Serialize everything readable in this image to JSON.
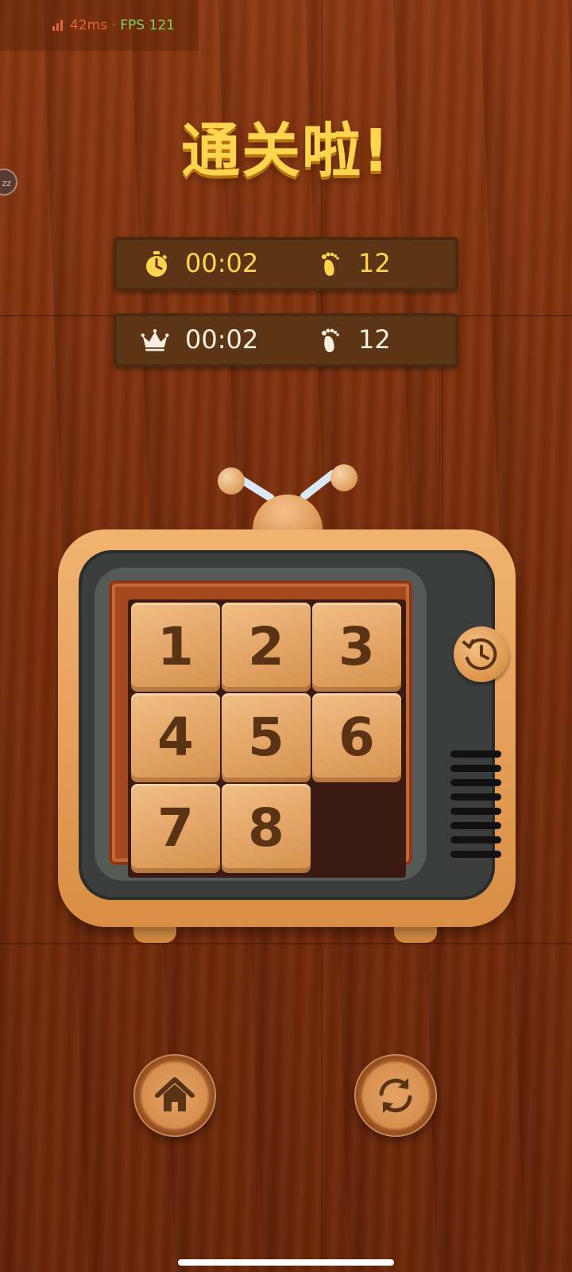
{
  "status": {
    "latency": "42ms",
    "separator": " · ",
    "fps": "FPS 121"
  },
  "side_chip": {
    "label": "zz"
  },
  "title": "通关啦!",
  "current": {
    "time": "00:02",
    "steps": "12",
    "time_icon": "stopwatch-icon",
    "steps_icon": "footprint-icon"
  },
  "best": {
    "time": "00:02",
    "steps": "12",
    "time_icon": "crown-icon",
    "steps_icon": "footprint-icon"
  },
  "board": {
    "tiles": [
      "1",
      "2",
      "3",
      "4",
      "5",
      "6",
      "7",
      "8"
    ],
    "empty_slot": 9
  },
  "buttons": {
    "undo_icon": "history-icon",
    "home_icon": "home-icon",
    "restart_icon": "refresh-icon"
  },
  "colors": {
    "title": "#ffd54f",
    "tile_text": "#5a3214",
    "bar": "#5c3516"
  }
}
